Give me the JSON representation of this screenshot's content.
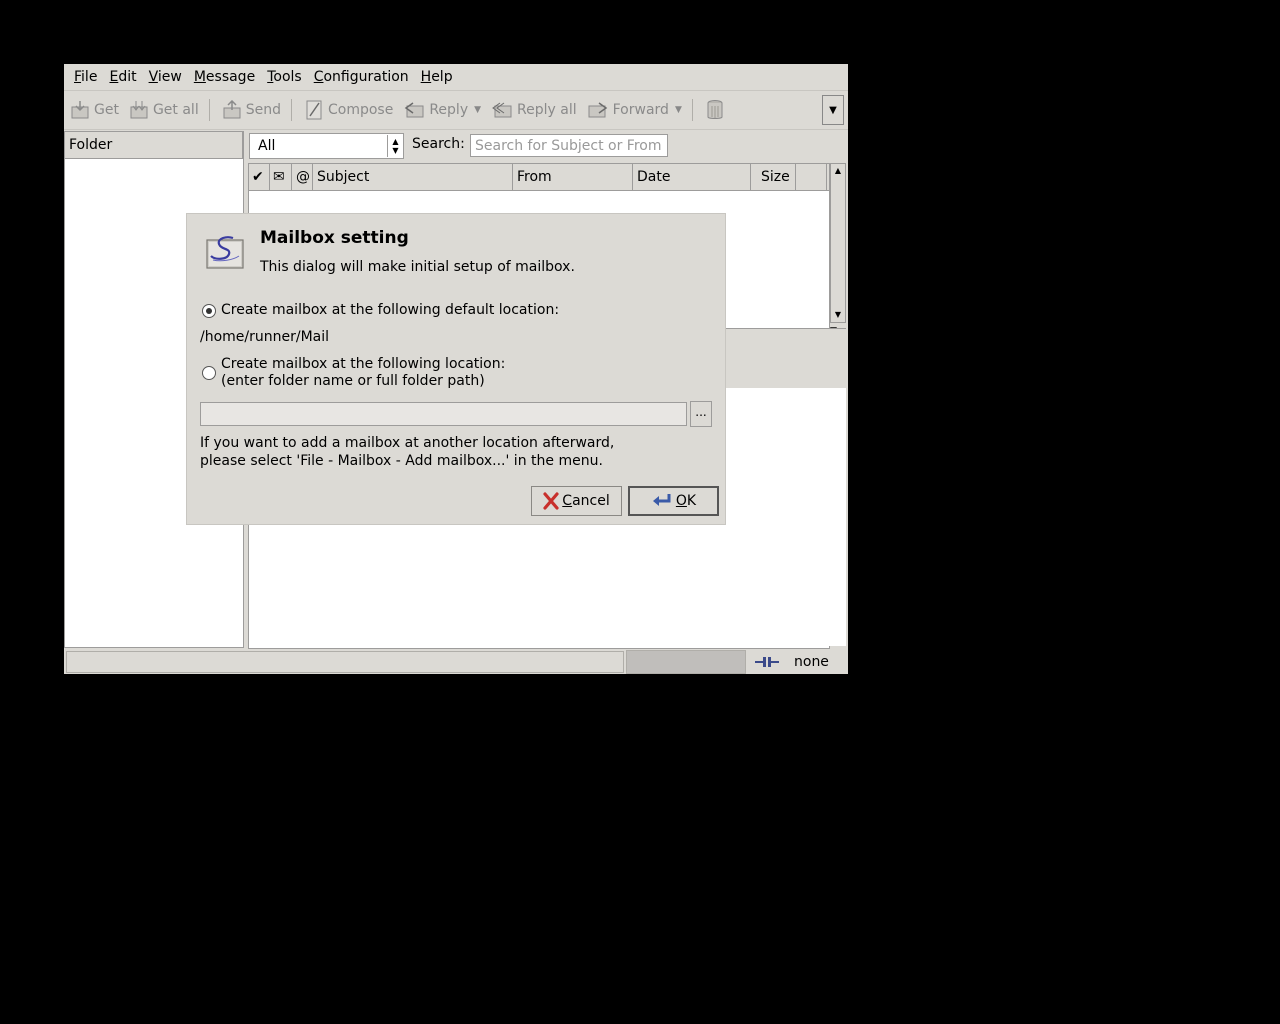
{
  "menubar": {
    "items": [
      {
        "label": "File",
        "u": "F",
        "rest": "ile"
      },
      {
        "label": "Edit",
        "u": "E",
        "rest": "dit"
      },
      {
        "label": "View",
        "u": "V",
        "rest": "iew"
      },
      {
        "label": "Message",
        "u": "M",
        "rest": "essage"
      },
      {
        "label": "Tools",
        "u": "T",
        "rest": "ools"
      },
      {
        "label": "Configuration",
        "u": "C",
        "rest": "onfiguration"
      },
      {
        "label": "Help",
        "u": "H",
        "rest": "elp"
      }
    ]
  },
  "toolbar": {
    "get": "Get",
    "get_all": "Get all",
    "send": "Send",
    "compose": "Compose",
    "reply": "Reply",
    "reply_all": "Reply all",
    "forward": "Forward"
  },
  "folder_pane": {
    "header": "Folder"
  },
  "summary": {
    "filter_value": "All",
    "search_label": "Search:",
    "search_placeholder": "Search for Subject or From",
    "columns": {
      "subject": "Subject",
      "from": "From",
      "date": "Date",
      "size": "Size"
    }
  },
  "statusbar": {
    "online_status": "none"
  },
  "dialog": {
    "title": "Mailbox setting",
    "description": "This dialog will make initial setup of mailbox.",
    "option_default": "Create mailbox at the following default location:",
    "default_path": "/home/runner/Mail",
    "option_custom_line1": "Create mailbox at the following location:",
    "option_custom_line2": "(enter folder name or full folder path)",
    "location_value": "",
    "browse_label": "...",
    "note_line1": "If you want to add a mailbox at another location afterward,",
    "note_line2": "please select 'File - Mailbox - Add mailbox...' in the menu.",
    "cancel_u": "C",
    "cancel_rest": "ancel",
    "ok_u": "O",
    "ok_rest": "K",
    "selected_option": "default"
  }
}
